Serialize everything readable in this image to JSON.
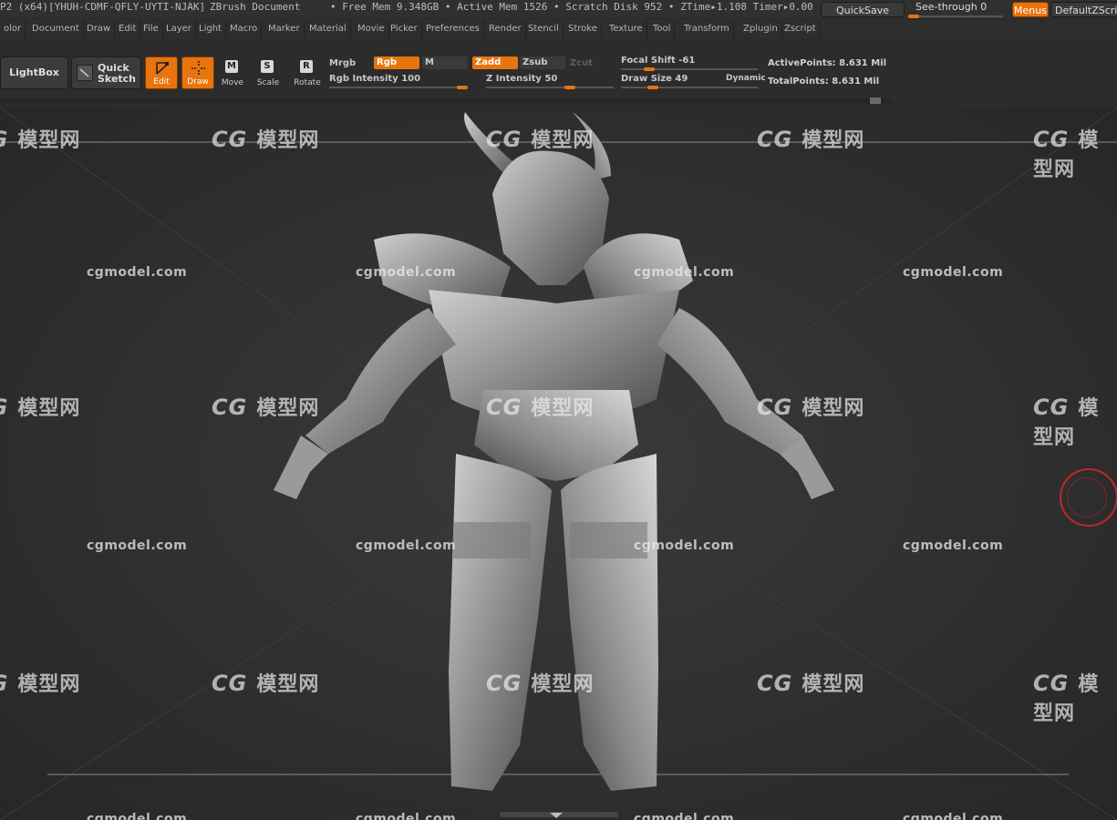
{
  "titlebar": {
    "app_id": "P2 (x64)[YHUH-CDMF-QFLY-UYTI-NJAK]",
    "doc": "ZBrush Document",
    "mem": "• Free Mem 9.348GB • Active Mem 1526 • Scratch Disk 952 • ZTime▸1.108 Timer▸0.00",
    "quicksave": "QuickSave",
    "seethrough": "See-through  0",
    "menus": "Menus",
    "default_script": "DefaultZScript"
  },
  "menubar": {
    "items": [
      "olor",
      "Document",
      "Draw",
      "Edit",
      "File",
      "Layer",
      "Light",
      "Macro",
      "Marker",
      "Material",
      "Movie",
      "Picker",
      "Preferences",
      "Render",
      "Stencil",
      "Stroke",
      "Texture",
      "Tool",
      "Transform",
      "Zplugin",
      "Zscript"
    ]
  },
  "shelf": {
    "lightbox": "LightBox",
    "quick_sketch_line1": "Quick",
    "quick_sketch_line2": "Sketch",
    "tools": [
      {
        "label": "Edit",
        "icon": "edit-icon",
        "active": true
      },
      {
        "label": "Draw",
        "icon": "draw-icon",
        "active": true
      },
      {
        "label": "Move",
        "glyph": "M",
        "active": false
      },
      {
        "label": "Scale",
        "glyph": "S",
        "active": false
      },
      {
        "label": "Rotate",
        "glyph": "R",
        "active": false
      }
    ],
    "mrgb": "Mrgb",
    "rgb": "Rgb",
    "m": "M",
    "zadd": "Zadd",
    "zsub": "Zsub",
    "zcut": "Zcut",
    "rgb_intensity": "Rgb Intensity 100",
    "z_intensity": "Z Intensity 50",
    "focal_shift": "Focal Shift -61",
    "draw_size": "Draw Size 49",
    "dynamic": "Dynamic",
    "active_points": "ActivePoints: 8.631 Mil",
    "total_points": "TotalPoints: 8.631 Mil"
  },
  "viewport": {
    "watermark_logo": "模型网",
    "watermark_logo_prefix": "CG",
    "watermark_text": "cgmodel.com"
  },
  "colors": {
    "accent": "#e8740e",
    "nav_ring": "#c0282a"
  }
}
